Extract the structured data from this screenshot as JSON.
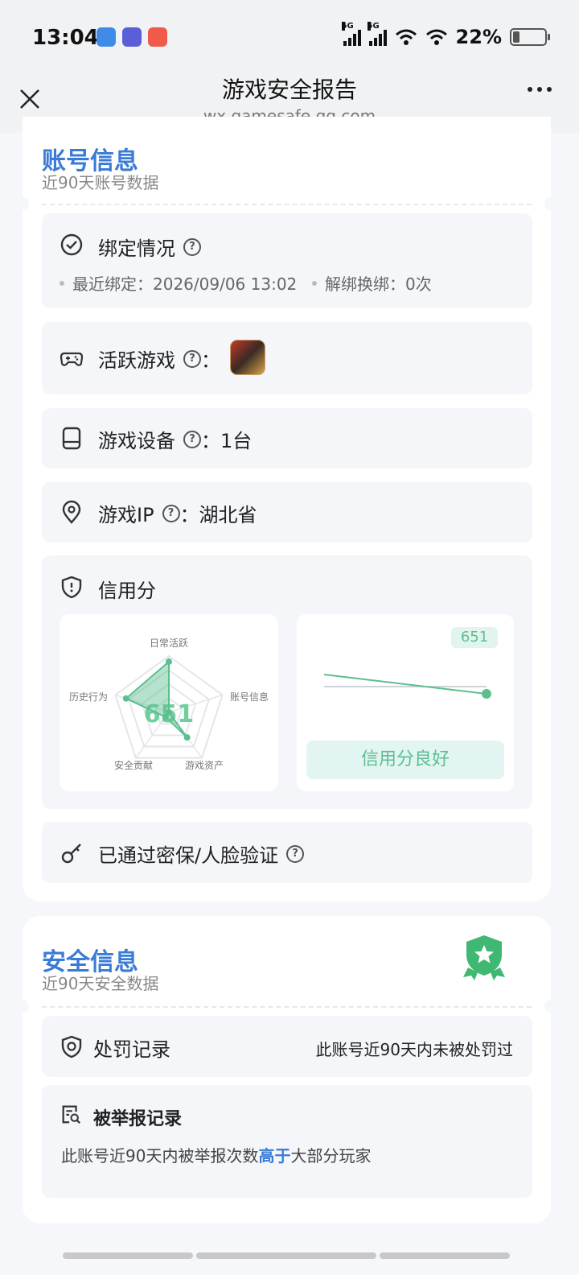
{
  "status": {
    "time": "13:04",
    "signal1": "5G",
    "signal2": "5G",
    "battery": "22%",
    "battery_level": 0.22
  },
  "titlebar": {
    "title": "游戏安全报告",
    "url": "wx.gamesafe.qq.com"
  },
  "account": {
    "title": "账号信息",
    "subtitle": "近90天账号数据",
    "binding": {
      "label": "绑定情况",
      "recent_label": "最近绑定：2026/09/06 13:02",
      "unbind_label": "解绑换绑：0次"
    },
    "active_game": {
      "label": "活跃游戏",
      "colon": "："
    },
    "device": {
      "label": "游戏设备",
      "value": "：1台"
    },
    "ip": {
      "label": "游戏IP",
      "value": "：湖北省"
    },
    "credit": {
      "label": "信用分",
      "score": "651",
      "status": "信用分良好",
      "radar_axes": [
        "日常活跃",
        "账号信息",
        "游戏资产",
        "安全贡献",
        "历史行为"
      ],
      "radar_values": [
        0.9,
        0.0,
        0.55,
        0.1,
        0.8
      ]
    },
    "verified": {
      "label": "已通过密保/人脸验证"
    }
  },
  "security": {
    "title": "安全信息",
    "subtitle": "近90天安全数据",
    "penalty": {
      "label": "处罚记录",
      "value": "此账号近90天内未被处罚过"
    },
    "report": {
      "label": "被举报记录",
      "line_prefix": "此账号近90天内被举报次数",
      "line_highlight": "高于",
      "line_suffix": "大部分玩家"
    }
  },
  "colors": {
    "accent_blue": "#3a7bd5",
    "accent_green": "#5cbf8f"
  }
}
